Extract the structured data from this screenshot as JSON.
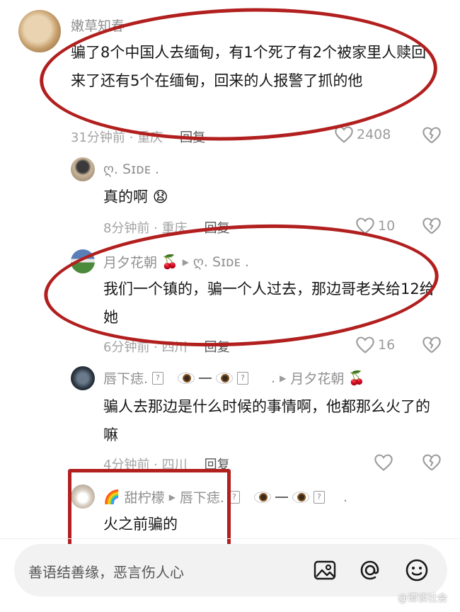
{
  "comments": [
    {
      "username": "嫩草知春",
      "text": "骗了8个中国人去缅甸，有1个死了有2个被家里人赎回来了还有5个在缅甸，回来的人报警了抓的他",
      "meta": "31分钟前 · 重庆",
      "reply_label": "回复",
      "likes": "2408"
    },
    {
      "username": "ღ. Sɪᴅᴇ .",
      "text": "真的啊",
      "emoji": "😧",
      "meta": "8分钟前 · 重庆",
      "reply_label": "回复",
      "likes": "10"
    },
    {
      "username": "月夕花朝",
      "username_emoji": "🍒",
      "reply_to": "ღ. Sɪᴅᴇ .",
      "text": "我们一个镇的，骗一个人过去，那边哥老关给12给她",
      "meta": "6分钟前 · 四川",
      "reply_label": "回复",
      "likes": "16"
    },
    {
      "username": "唇下痣.",
      "username_tail": ".",
      "reply_to": "月夕花朝",
      "reply_to_emoji": "🍒",
      "text": "骗人去那边是什么时候的事情啊，他都那么火了的嘛",
      "meta": "4分钟前 · 四川",
      "reply_label": "回复",
      "likes": ""
    },
    {
      "username_prefix": "🌈",
      "username": "甜柠檬",
      "reply_to": "唇下痣.",
      "reply_to_tail": ".",
      "text": "火之前骗的"
    }
  ],
  "input": {
    "placeholder": "善语结善缘，恶言伤人心"
  },
  "icons": {
    "image": "image-icon",
    "mention": "at-icon",
    "emoji": "smiley-icon",
    "like": "heart-icon",
    "dislike": "broken-heart-icon"
  },
  "annotation_color": "#b21f1f",
  "watermark": "@谭谈社会"
}
